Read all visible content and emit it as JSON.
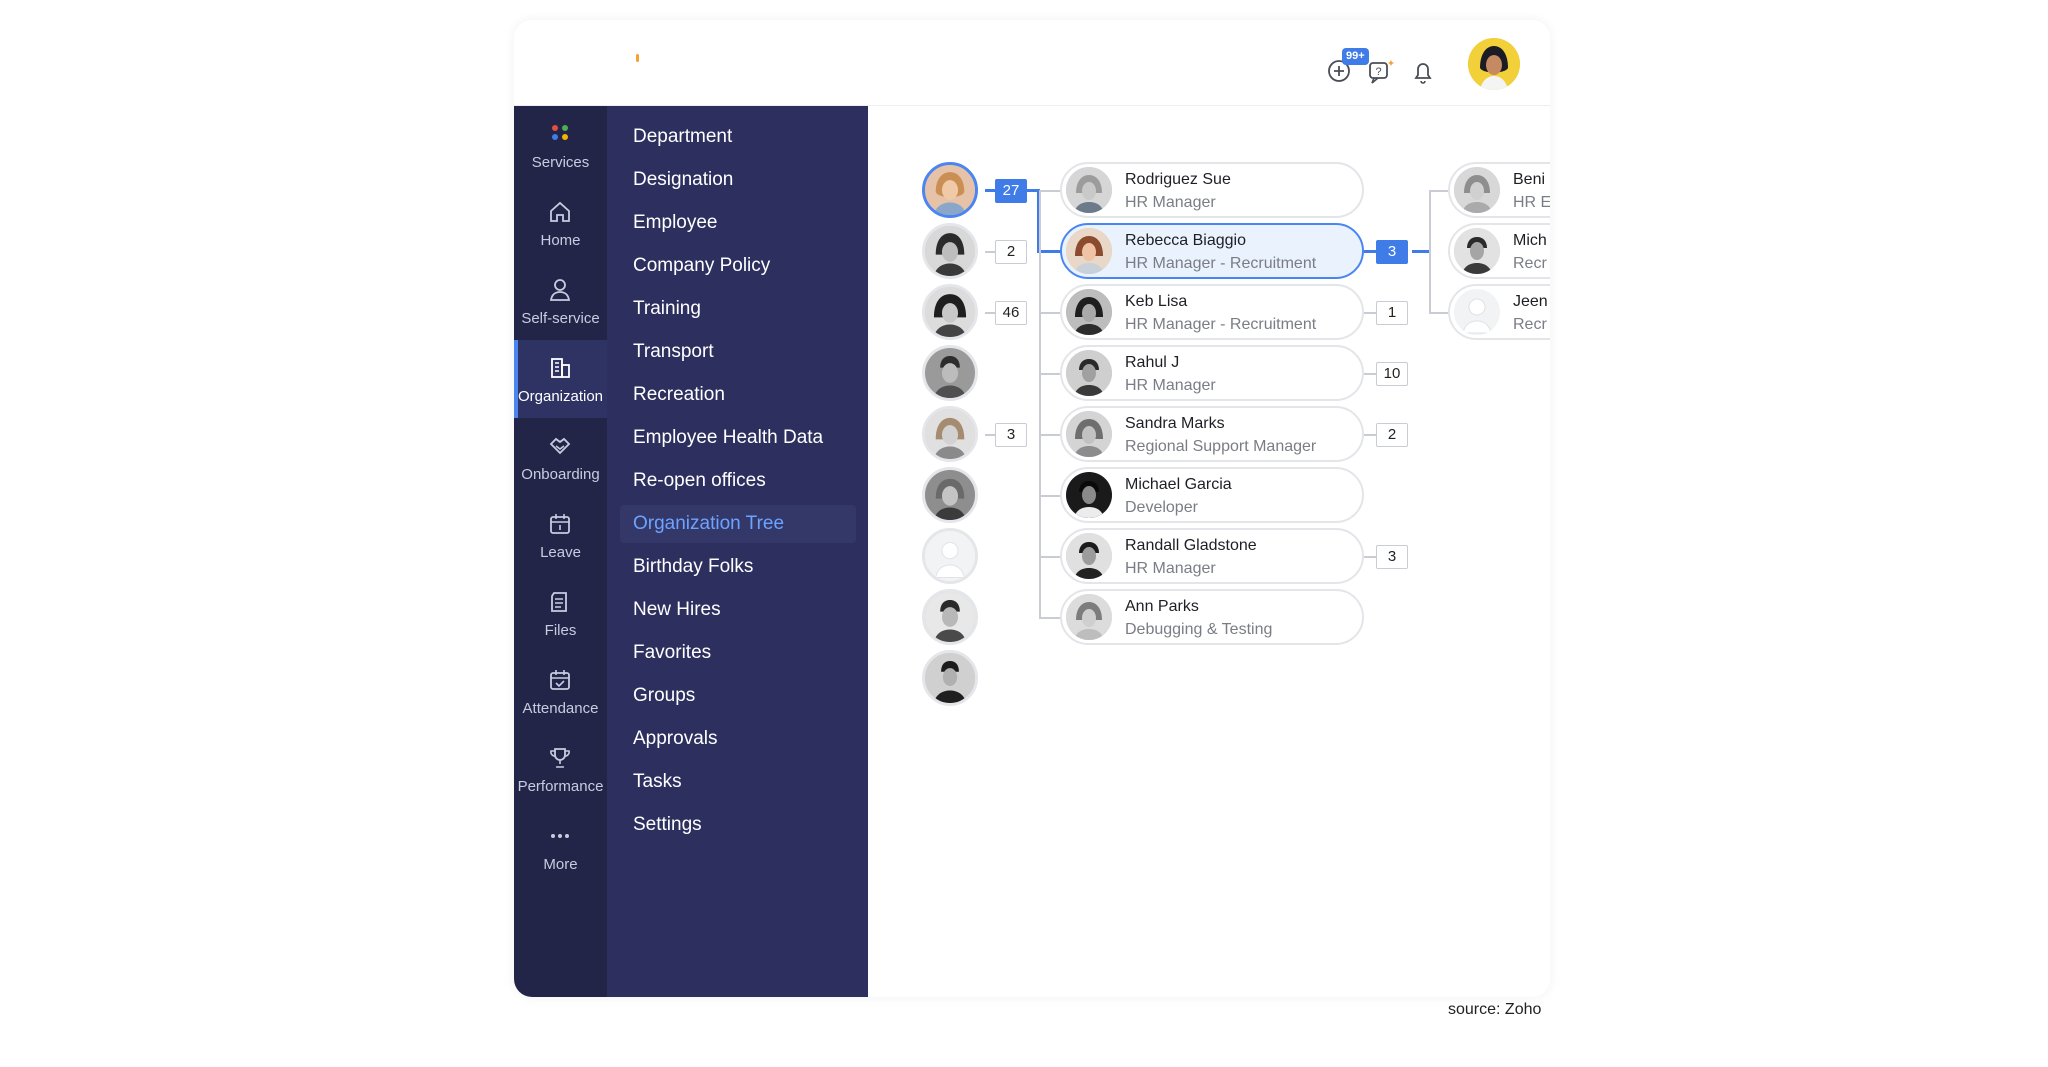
{
  "topbar": {
    "notification_badge": "99+",
    "icons": [
      "add-circle-icon",
      "help-sparkle-icon",
      "bell-icon"
    ]
  },
  "rail": [
    {
      "label": "Services",
      "icon": "services-dots-icon"
    },
    {
      "label": "Home",
      "icon": "home-icon"
    },
    {
      "label": "Self-service",
      "icon": "person-icon"
    },
    {
      "label": "Organization",
      "icon": "building-icon",
      "active": true
    },
    {
      "label": "Onboarding",
      "icon": "handshake-icon"
    },
    {
      "label": "Leave",
      "icon": "calendar-icon"
    },
    {
      "label": "Files",
      "icon": "files-icon"
    },
    {
      "label": "Attendance",
      "icon": "calendar-check-icon"
    },
    {
      "label": "Performance",
      "icon": "trophy-icon"
    },
    {
      "label": "More",
      "icon": "more-dots-icon"
    }
  ],
  "submenu": [
    "Department",
    "Designation",
    "Employee",
    "Company Policy",
    "Training",
    "Transport",
    "Recreation",
    "Employee Health Data",
    "Re-open offices",
    "Organization Tree",
    "Birthday Folks",
    "New Hires",
    "Favorites",
    "Groups",
    "Approvals",
    "Tasks",
    "Settings"
  ],
  "submenu_active": "Organization Tree",
  "tree": {
    "level1_counts": [
      "27",
      "2",
      "46",
      "",
      "3",
      "",
      "",
      "",
      ""
    ],
    "level2": [
      {
        "name": "Rodriguez Sue",
        "role": "HR Manager",
        "count": ""
      },
      {
        "name": "Rebecca Biaggio",
        "role": "HR Manager - Recruitment",
        "count": "3",
        "selected": true
      },
      {
        "name": "Keb Lisa",
        "role": "HR Manager - Recruitment",
        "count": "1"
      },
      {
        "name": "Rahul J",
        "role": "HR Manager",
        "count": "10"
      },
      {
        "name": "Sandra Marks",
        "role": "Regional Support Manager",
        "count": "2"
      },
      {
        "name": "Michael Garcia",
        "role": "Developer",
        "count": ""
      },
      {
        "name": "Randall Gladstone",
        "role": "HR Manager",
        "count": "3"
      },
      {
        "name": "Ann Parks",
        "role": "Debugging & Testing",
        "count": ""
      }
    ],
    "level3": [
      {
        "name": "Beni",
        "role": "HR E"
      },
      {
        "name": "Mich",
        "role": "Recr"
      },
      {
        "name": "Jeen",
        "role": "Recr"
      }
    ]
  },
  "source": "source: Zoho",
  "colors": {
    "accent": "#3f7ce8",
    "rail_bg": "#232548",
    "submenu_bg": "#2d2f5e",
    "active_text": "#6ea2ff"
  }
}
